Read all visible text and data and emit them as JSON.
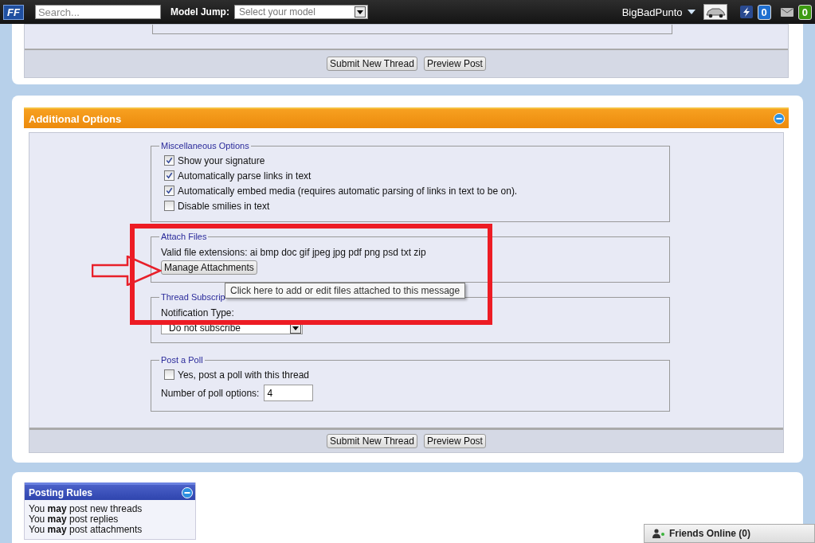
{
  "top_bar": {
    "logo": "FF",
    "search": {
      "placeholder": "Search..."
    },
    "model_jump": {
      "label": "Model Jump:",
      "placeholder": "Select your model"
    },
    "username": "BigBadPunto",
    "notifications": [
      {
        "kind": "alerts",
        "count": "0",
        "color": "#1f6fd0"
      },
      {
        "kind": "messages",
        "count": "0",
        "color": "#3d9a12"
      }
    ]
  },
  "top_form": {
    "buttons": [
      "Submit New Thread",
      "Preview Post"
    ]
  },
  "additional_options": {
    "title": "Additional Options",
    "misc": {
      "legend": "Miscellaneous Options",
      "options": [
        {
          "label": "Show your signature",
          "checked": true
        },
        {
          "label": "Automatically parse links in text",
          "checked": true
        },
        {
          "label": "Automatically embed media (requires automatic parsing of links in text to be on).",
          "checked": true
        },
        {
          "label": "Disable smilies in text",
          "checked": false
        }
      ]
    },
    "attach": {
      "legend": "Attach Files",
      "extensions": "Valid file extensions: ai bmp doc gif jpeg jpg pdf png psd txt zip",
      "button": "Manage Attachments",
      "tooltip": "Click here to add or edit files attached to this message"
    },
    "subscription": {
      "legend": "Thread Subscrip",
      "label": "Notification Type:",
      "value": "Do not subscribe"
    },
    "poll": {
      "legend": "Post a Poll",
      "option": {
        "label": "Yes, post a poll with this thread",
        "checked": false
      },
      "count_label": "Number of poll options:",
      "count": "4"
    },
    "buttons": [
      "Submit New Thread",
      "Preview Post"
    ]
  },
  "posting_rules": {
    "title": "Posting Rules",
    "rules": [
      "You **may** post new threads",
      "You **may** post replies",
      "You **may** post attachments"
    ]
  },
  "friends_online": "Friends Online (0)"
}
